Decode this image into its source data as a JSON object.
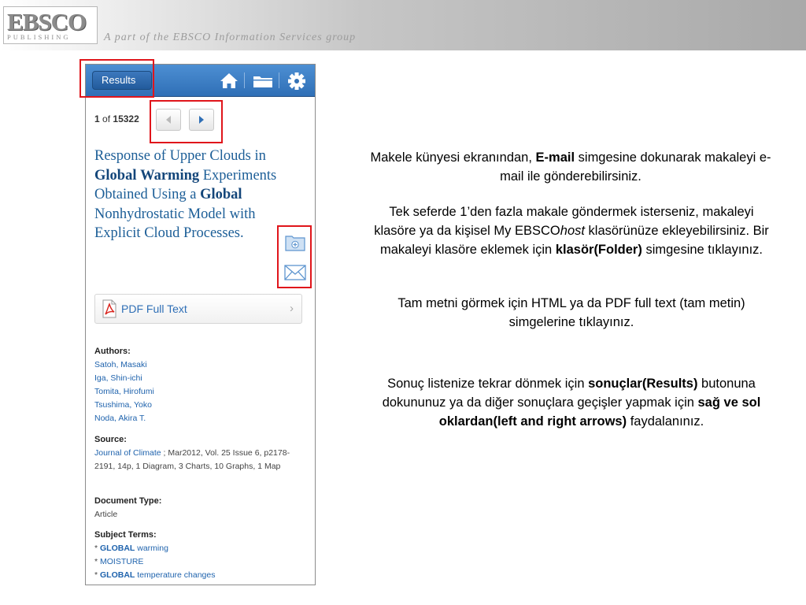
{
  "banner": {
    "logo_main": "EBSCO",
    "logo_sub": "PUBLISHING",
    "tagline": "A part of the EBSCO Information Services group"
  },
  "app": {
    "results_button": "Results",
    "icons": [
      "home-icon",
      "folder-icon",
      "gear-icon"
    ],
    "counter": {
      "current": "1",
      "of": "of",
      "total": "15322"
    },
    "nav_icons": [
      "chevron-left-icon",
      "chevron-right-icon"
    ],
    "title_segments": [
      {
        "text": "Response of Upper Clouds in ",
        "bold": false
      },
      {
        "text": "Global",
        "bold": true
      },
      {
        "text": " ",
        "bold": false
      },
      {
        "text": "Warming",
        "bold": true
      },
      {
        "text": " Experiments Obtained Using a ",
        "bold": false
      },
      {
        "text": "Global",
        "bold": true
      },
      {
        "text": " Nonhydrostatic Model with Explicit Cloud Processes",
        "bold": false
      },
      {
        "text": ".",
        "bold": false
      }
    ],
    "side_icons": [
      "add-to-folder-icon",
      "email-icon"
    ],
    "pdf": {
      "label": "PDF Full Text",
      "icon": "pdf-icon",
      "chevron": "›"
    },
    "authors": {
      "heading": "Authors:",
      "items": [
        "Satoh, Masaki",
        "Iga, Shin-ichi",
        "Tomita, Hirofumi",
        "Tsushima, Yoko",
        "Noda, Akira T."
      ]
    },
    "source": {
      "heading": "Source:",
      "journal": "Journal of Climate",
      "details": " ; Mar2012, Vol. 25 Issue 6, p2178-2191, 14p, 1 Diagram, 3 Charts, 10 Graphs, 1 Map"
    },
    "doctype": {
      "heading": "Document Type:",
      "value": "Article"
    },
    "subjects": {
      "heading": "Subject Terms:",
      "items": [
        [
          {
            "text": "GLOBAL",
            "bold": true
          },
          {
            "text": " warming",
            "bold": false
          }
        ],
        [
          {
            "text": "MOISTURE",
            "bold": false
          }
        ],
        [
          {
            "text": "GLOBAL",
            "bold": true
          },
          {
            "text": " temperature changes",
            "bold": false
          }
        ]
      ]
    }
  },
  "instructions": [
    [
      {
        "text": "Makele künyesi ekranından, ",
        "bold": false
      },
      {
        "text": "E-mail",
        "bold": true
      },
      {
        "text": " simgesine dokunarak makaleyi e-mail ile gönderebilirsiniz.",
        "bold": false
      }
    ],
    [
      {
        "text": "Tek seferde 1’den fazla makale göndermek isterseniz, makaleyi klasöre ya da kişisel My EBSCO",
        "bold": false
      },
      {
        "text": "host",
        "italic": true
      },
      {
        "text": " klasörünüze ekleyebilirsiniz. Bir makaleyi klasöre eklemek için ",
        "bold": false
      },
      {
        "text": "klasör(Folder)",
        "bold": true
      },
      {
        "text": " simgesine tıklayınız.",
        "bold": false
      }
    ],
    [
      {
        "text": "Tam metni görmek için HTML ya da PDF full text (tam metin) simgelerine tıklayınız.",
        "bold": false
      }
    ],
    [
      {
        "text": "Sonuç listenize tekrar dönmek için ",
        "bold": false
      },
      {
        "text": "sonuçlar(Results)",
        "bold": true
      },
      {
        "text": " butonuna dokununuz ya da diğer sonuçlara geçişler yapmak için ",
        "bold": false
      },
      {
        "text": "sağ ve sol oklardan(left and right arrows)",
        "bold": true
      },
      {
        "text": " faydalanınız.",
        "bold": false
      }
    ]
  ],
  "colors": {
    "appbar": "#2f6fb6",
    "title": "#1c5e97",
    "link": "#1f63ad",
    "highlight": "#e0151b"
  }
}
